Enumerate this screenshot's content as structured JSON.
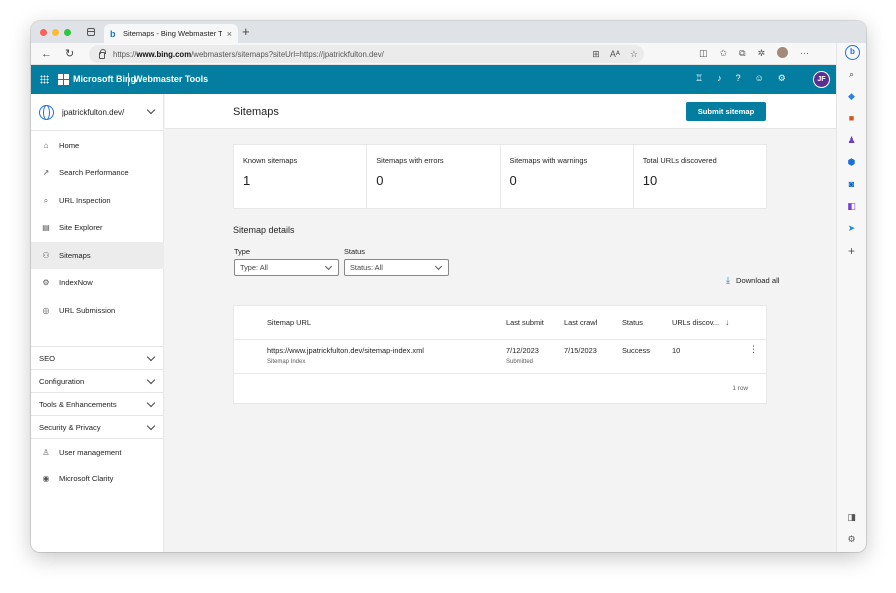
{
  "browser": {
    "tab_title": "Sitemaps - Bing Webmaster Tc",
    "tab_close": "×",
    "new_tab": "+",
    "url_prefix": "https://",
    "url_host": "www.bing.com",
    "url_path": "/webmasters/sitemaps?siteUrl=https://jpatrickfulton.dev/",
    "icons": [
      "tab-actions-icon",
      "back-icon",
      "refresh-icon",
      "lock-icon",
      "app-icon",
      "read-aloud-icon",
      "favorite-icon",
      "split-screen-icon",
      "favorites-icon",
      "collections-icon",
      "extensions-icon",
      "profile-icon",
      "more-icon",
      "bing-chat-icon"
    ]
  },
  "edge_sidebar": {
    "icons": [
      "search-icon",
      "shopping-icon",
      "tools-icon",
      "games-icon",
      "office-icon",
      "outlook-icon",
      "designer-icon",
      "send-icon",
      "add-icon",
      "sidebar-toggle-icon",
      "settings-icon"
    ],
    "bing_label": "b",
    "add_label": "+"
  },
  "header": {
    "brand": "Microsoft Bing",
    "product": "Webmaster Tools",
    "icons": [
      "trophy-icon",
      "bell-icon",
      "help-icon",
      "smiley-icon",
      "gear-icon"
    ],
    "help_label": "?",
    "avatar_initials": "JF",
    "brand_color": "#047ea0"
  },
  "sidebar": {
    "site": "jpatrickfulton.dev/",
    "items": [
      {
        "label": "Home",
        "icon": "home-icon",
        "glyph": "⌂"
      },
      {
        "label": "Search Performance",
        "icon": "trend-icon",
        "glyph": "↗"
      },
      {
        "label": "URL Inspection",
        "icon": "inspect-icon",
        "glyph": "⌕"
      },
      {
        "label": "Site Explorer",
        "icon": "document-icon",
        "glyph": "▤"
      },
      {
        "label": "Sitemaps",
        "icon": "sitemap-icon",
        "glyph": "⚇"
      },
      {
        "label": "IndexNow",
        "icon": "indexnow-icon",
        "glyph": "⚙"
      },
      {
        "label": "URL Submission",
        "icon": "globe-icon",
        "glyph": "◎"
      }
    ],
    "groups": [
      {
        "label": "SEO"
      },
      {
        "label": "Configuration"
      },
      {
        "label": "Tools & Enhancements"
      },
      {
        "label": "Security & Privacy"
      }
    ],
    "bottom_items": [
      {
        "label": "User management",
        "icon": "user-icon",
        "glyph": "♙"
      },
      {
        "label": "Microsoft Clarity",
        "icon": "clarity-icon",
        "glyph": "◉"
      }
    ]
  },
  "main": {
    "title": "Sitemaps",
    "submit_label": "Submit sitemap",
    "stats": [
      {
        "label": "Known sitemaps",
        "value": "1"
      },
      {
        "label": "Sitemaps with errors",
        "value": "0"
      },
      {
        "label": "Sitemaps with warnings",
        "value": "0"
      },
      {
        "label": "Total URLs discovered",
        "value": "10"
      }
    ],
    "details_title": "Sitemap details",
    "filters": {
      "type_label": "Type",
      "type_value": "Type: All",
      "status_label": "Status",
      "status_value": "Status: All"
    },
    "download_label": "Download all",
    "table": {
      "columns": [
        "Sitemap URL",
        "Last submit",
        "Last crawl",
        "Status",
        "URLs discov..."
      ],
      "rows": [
        {
          "url": "https://www.jpatrickfulton.dev/sitemap-index.xml",
          "type": "Sitemap Index",
          "last_submit": "7/12/2023",
          "submit_note": "Submitted",
          "last_crawl": "7/15/2023",
          "status": "Success",
          "urls": "10"
        }
      ],
      "row_count": "1 row"
    }
  }
}
